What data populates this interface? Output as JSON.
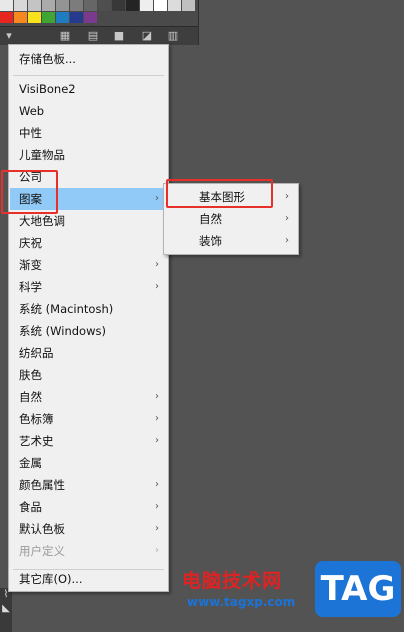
{
  "swatches": {
    "row1": [
      "#e8e8e8",
      "#d8d8d8",
      "#c4c4c4",
      "#ababab",
      "#949494",
      "#7c7c7c",
      "#666666",
      "#4f4f4f",
      "#383838",
      "#242424",
      "#eeeeee",
      "#ffffff",
      "#dcdcdc",
      "#c0c0c0"
    ],
    "row2": [
      "#e6261f",
      "#f6881f",
      "#f7e21b",
      "#3fa535",
      "#1f7cc1",
      "#263b8f",
      "#7c3a8f"
    ]
  },
  "panel_toolbar": {
    "icons": [
      "library-icon",
      "grid-icon",
      "folder-icon",
      "new-swatch-icon",
      "trash-icon"
    ]
  },
  "menu": {
    "save_swatches": "存储色板...",
    "items": [
      {
        "label": "VisiBone2",
        "arrow": ""
      },
      {
        "label": "Web",
        "arrow": ""
      },
      {
        "label": "中性",
        "arrow": ""
      },
      {
        "label": "儿童物品",
        "arrow": ""
      },
      {
        "label": "公司",
        "arrow": ""
      },
      {
        "label": "图案",
        "arrow": "›"
      },
      {
        "label": "大地色调",
        "arrow": ""
      },
      {
        "label": "庆祝",
        "arrow": ""
      },
      {
        "label": "渐变",
        "arrow": "›"
      },
      {
        "label": "科学",
        "arrow": "›"
      },
      {
        "label": "系统 (Macintosh)",
        "arrow": ""
      },
      {
        "label": "系统 (Windows)",
        "arrow": ""
      },
      {
        "label": "纺织品",
        "arrow": ""
      },
      {
        "label": "肤色",
        "arrow": ""
      },
      {
        "label": "自然",
        "arrow": "›"
      },
      {
        "label": "色标簿",
        "arrow": "›"
      },
      {
        "label": "艺术史",
        "arrow": "›"
      },
      {
        "label": "金属",
        "arrow": ""
      },
      {
        "label": "颜色属性",
        "arrow": "›"
      },
      {
        "label": "食品",
        "arrow": "›"
      },
      {
        "label": "默认色板",
        "arrow": "›"
      },
      {
        "label": "用户定义",
        "arrow": "›"
      }
    ],
    "other_library": "其它库(O)..."
  },
  "submenu": {
    "items": [
      {
        "label": "基本图形",
        "arrow": "›"
      },
      {
        "label": "自然",
        "arrow": "›"
      },
      {
        "label": "装饰",
        "arrow": "›"
      }
    ]
  },
  "watermark": {
    "site_name": "电脑技术网",
    "url": "www.tagxp.com",
    "badge": "TAG"
  }
}
